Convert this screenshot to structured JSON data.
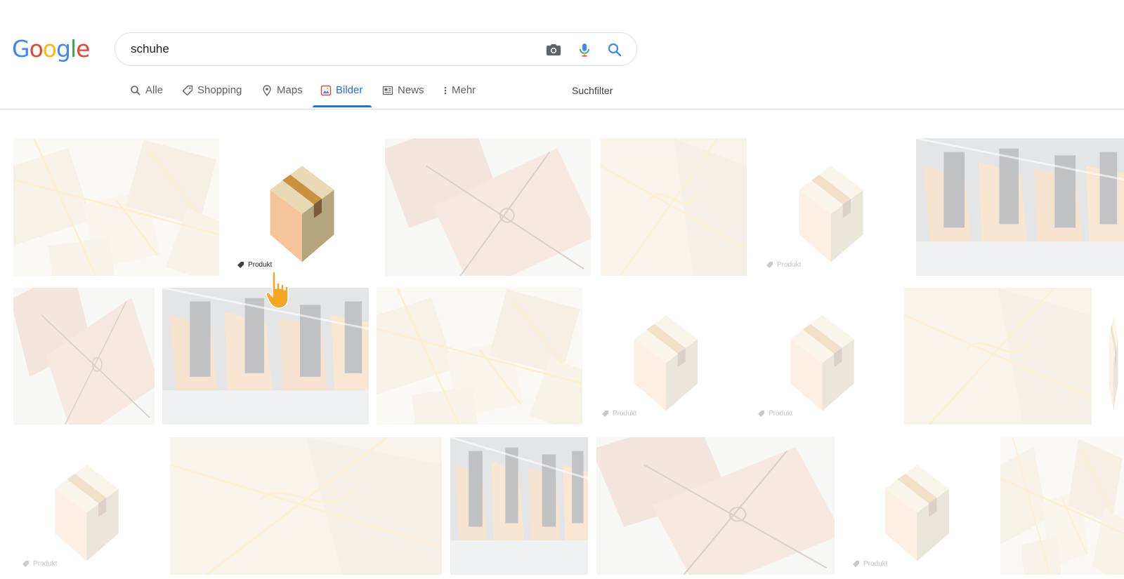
{
  "logo": {
    "letters": [
      "G",
      "o",
      "o",
      "g",
      "l",
      "e"
    ],
    "colors": [
      "#4285F4",
      "#EA4335",
      "#FBBC05",
      "#4285F4",
      "#34A853",
      "#EA4335"
    ]
  },
  "search": {
    "query": "schuhe",
    "icons": [
      "camera-icon",
      "microphone-icon",
      "search-icon"
    ]
  },
  "tabs": [
    {
      "label": "Alle",
      "icon": "search-icon"
    },
    {
      "label": "Shopping",
      "icon": "tag-icon"
    },
    {
      "label": "Maps",
      "icon": "map-pin-icon"
    },
    {
      "label": "Bilder",
      "icon": "image-icon",
      "active": true
    },
    {
      "label": "News",
      "icon": "newspaper-icon"
    },
    {
      "label": "Mehr",
      "icon": "more-vertical-icon"
    }
  ],
  "tools": {
    "filter_label": "Suchfilter"
  },
  "results": {
    "badge_label": "Produkt",
    "image_kinds": [
      "parcels",
      "box",
      "wrapped-parcel",
      "twine-parcel",
      "box",
      "bags",
      "wrapped-parcel",
      "bags",
      "parcels",
      "box",
      "box",
      "twine-parcel",
      "box",
      "twine-parcel",
      "bags",
      "wrapped-parcel",
      "box",
      "parcels"
    ],
    "highlighted_index": 1
  },
  "colors": {
    "accent": "#1a73e8",
    "text_muted": "#5f6368",
    "divider": "#dadce0"
  },
  "cursor": {
    "icon": "hand-pointer-icon"
  }
}
